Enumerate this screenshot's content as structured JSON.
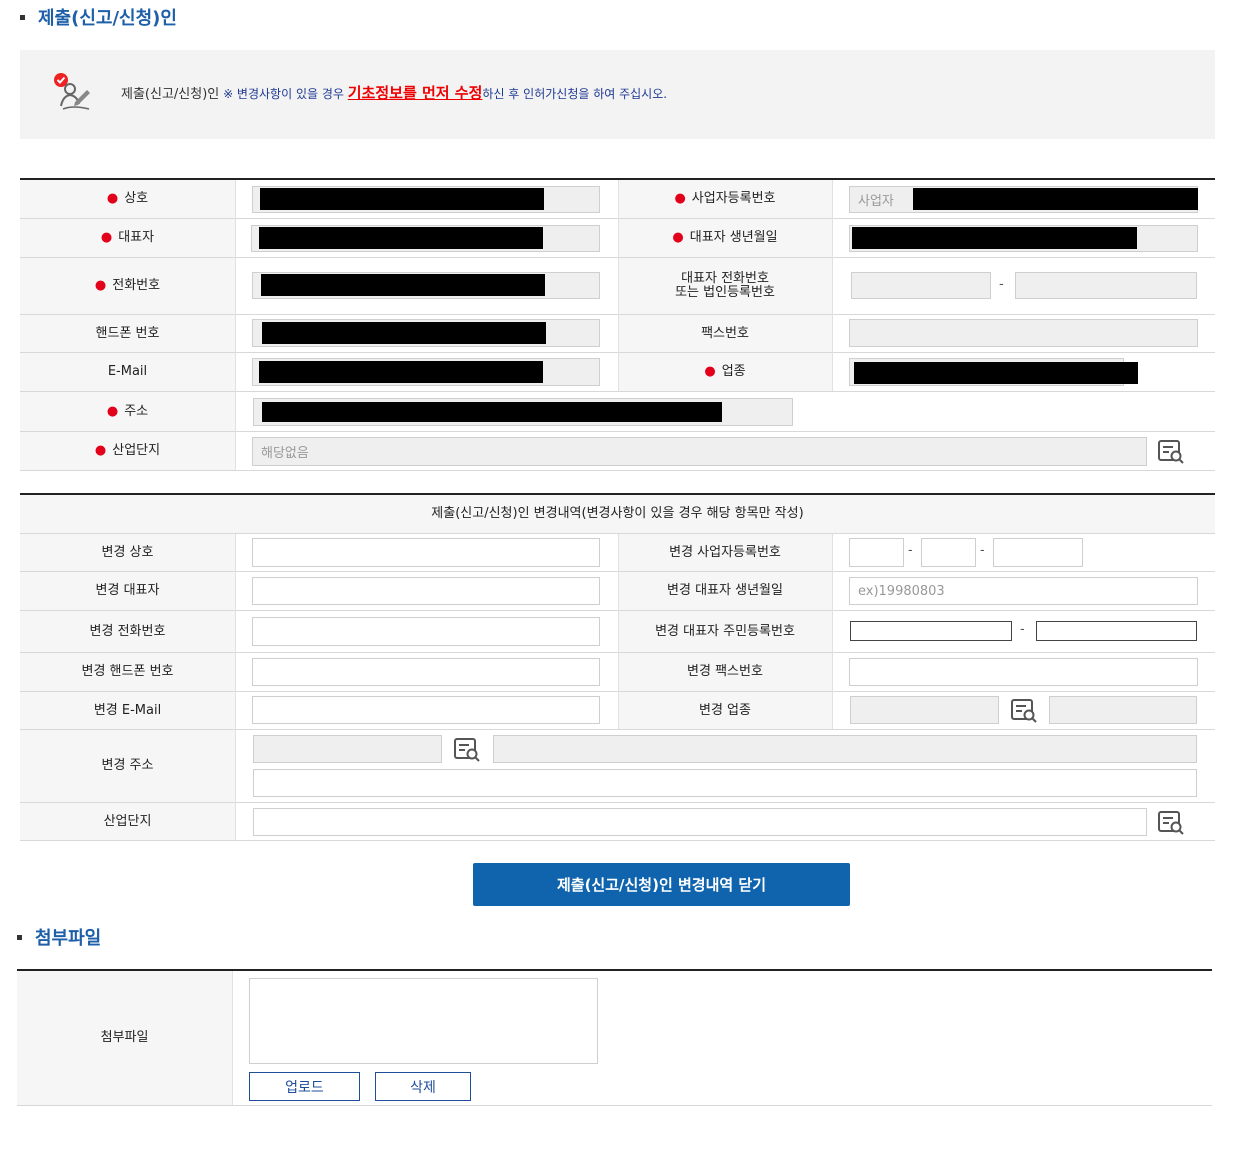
{
  "section1": {
    "title": "제출(신고/신청)인"
  },
  "notice": {
    "lead": "제출(신고/신청)인",
    "part1": " ※ 변경사항이 있을 경우 ",
    "highlight": "기초정보를 먼저 수정",
    "part2": "하신 후 인허가신청을 하여 주십시오."
  },
  "info": {
    "company_label": "상호",
    "biz_reg_label": "사업자등록번호",
    "biz_reg_placeholder": "사업자",
    "ceo_label": "대표자",
    "ceo_birth_label": "대표자 생년월일",
    "phone_label": "전화번호",
    "ceo_phone_label_1": "대표자 전화번호",
    "ceo_phone_label_2": "또는 법인등록번호",
    "mobile_label": "핸드폰 번호",
    "fax_label": "팩스번호",
    "email_label": "E-Mail",
    "industry_label": "업종",
    "address_label": "주소",
    "complex_label": "산업단지",
    "complex_value": "해당없음",
    "dash": "-"
  },
  "change": {
    "header": "제출(신고/신청)인 변경내역(변경사항이 있을 경우 해당 항목만 작성)",
    "company_label": "변경 상호",
    "biz_reg_label": "변경 사업자등록번호",
    "ceo_label": "변경 대표자",
    "ceo_birth_label": "변경 대표자 생년월일",
    "ceo_birth_placeholder": "ex)19980803",
    "phone_label": "변경 전화번호",
    "ceo_rrn_label": "변경 대표자 주민등록번호",
    "mobile_label": "변경 핸드폰 번호",
    "fax_label": "변경 팩스번호",
    "email_label": "변경 E-Mail",
    "industry_label": "변경 업종",
    "address_label": "변경 주소",
    "complex_label": "산업단지"
  },
  "close_button": "제출(신고/신청)인 변경내역 닫기",
  "section2": {
    "title": "첨부파일"
  },
  "attach": {
    "label": "첨부파일",
    "upload_button": "업로드",
    "delete_button": "삭제"
  }
}
